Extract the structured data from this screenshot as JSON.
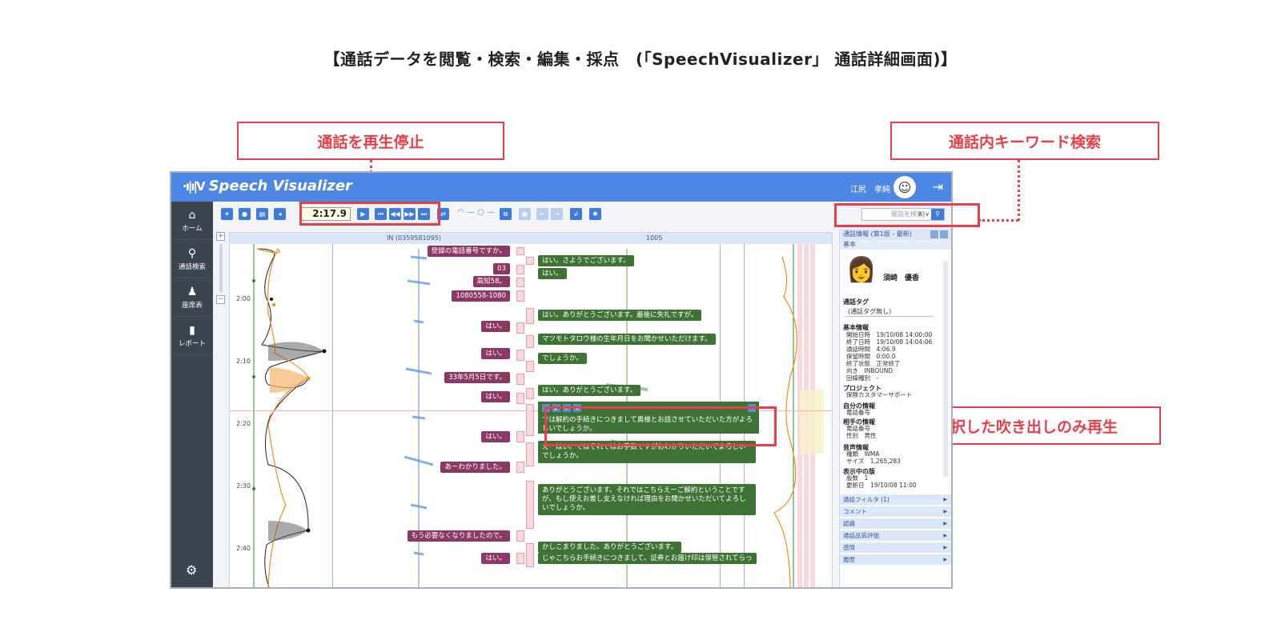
{
  "page_title": "【通話データを閲覧・検索・編集・採点　(「SpeechVisualizer」 通話詳細画面)】",
  "callouts": {
    "playback": "通話を再生停止",
    "keyword_search": "通話内キーワード検索",
    "bubble_play": "選択した吹き出しのみ再生"
  },
  "app": {
    "logo_mark": "·ı|ı|V",
    "logo_text": "Speech Visualizer",
    "user_name": "江尻　孝純",
    "nav": [
      {
        "label": "ホーム",
        "icon": "⌂"
      },
      {
        "label": "通話検索",
        "icon": "⚲"
      },
      {
        "label": "座席表",
        "icon": "♟"
      },
      {
        "label": "レポート",
        "icon": "▮"
      }
    ],
    "time": "2:17.9",
    "search_placeholder": "発話を検索",
    "channel_in": "IN  (0359581095)",
    "channel_out": "1005",
    "time_labels": [
      "2:00",
      "2:10",
      "2:20",
      "2:30",
      "2:40"
    ],
    "bubbles_left": [
      "登録の電話番号ですか。",
      "03",
      "高知58。",
      "1080558-1080",
      "はい。",
      "はい。",
      "33年5月5日です。",
      "はい。",
      "はい。",
      "あーわかりました。",
      "もう必要なくなりましたので。",
      "はい。"
    ],
    "bubbles_right": [
      "はい。さようでございます。",
      "はい。",
      "はい。ありがとうございます。最後に失礼ですが。",
      "マツモトタロウ様の生年月日をお聞かせいただけます。",
      "でしょうか。",
      "はい。ありがとうございます。",
      "では解約の手続きにつきまして奥様とお話させていただいた方がよろしいでしょうか。",
      "えーはい。ではそれではお手数ですがおわかりいただいてよろしいでしょうか。",
      "ありがとうございます。それではこちらえーご解約ということですが、もし使えお差し支えなければ理由をお聞かせいただいてよろしいでしょうか。",
      "かしこまりました。ありがとうございます。",
      "じゃこちらお手続きにつきまして、証券とお届け印は保管されてらっ"
    ],
    "panel": {
      "title": "通話情報 (第1版 - 最新)",
      "sub": "基本",
      "person": "須崎　優香",
      "tag_section": "通話タグ",
      "tag_value": "(通話タグ無し)",
      "basic_section": "基本情報",
      "basic": [
        [
          "開始日時",
          "19/10/08 14:00:00"
        ],
        [
          "終了日時",
          "19/10/08 14:04:06"
        ],
        [
          "通話時間",
          "4:06.9"
        ],
        [
          "保留時間",
          "0:00.0"
        ],
        [
          "終了状態",
          "正常終了"
        ],
        [
          "向き",
          "INBOUND"
        ],
        [
          "回線種別",
          "-"
        ]
      ],
      "project_section": "プロジェクト",
      "project_value": "保険カスタマーサポート",
      "self_section": "自分の情報",
      "self_row": "電話番号",
      "other_section": "相手の情報",
      "other_rows": [
        [
          "電話番号",
          ""
        ],
        [
          "性別",
          "男性"
        ]
      ],
      "audio_section": "音声情報",
      "audio_rows": [
        [
          "種類",
          "WMA"
        ],
        [
          "サイズ",
          "1,265,283"
        ]
      ],
      "version_section": "表示中の版",
      "version_rows": [
        [
          "版数",
          "1"
        ],
        [
          "更新日",
          "19/10/08 11:00"
        ]
      ],
      "accordions": [
        "通話フィルタ (1)",
        "コメント",
        "認識",
        "通話品質評価",
        "感情",
        "履歴"
      ]
    }
  },
  "colors": {
    "accent": "#e8404a",
    "topbar": "#4e86e4",
    "left_bubble": "#8c3864",
    "right_bubble": "#3f7335"
  }
}
